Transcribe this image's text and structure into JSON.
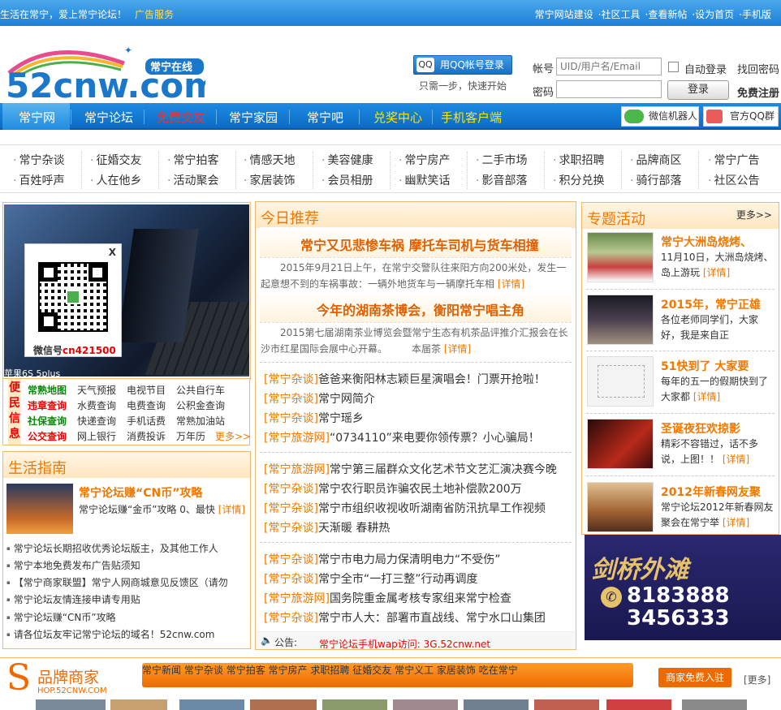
{
  "topbar": {
    "slogan": "生活在常宁，爱上常宁论坛！",
    "ad": "广告服务",
    "links": [
      "常宁网站建设",
      "·社区工具",
      "·查看新帖",
      "·设为首页",
      "·手机版"
    ]
  },
  "logo": {
    "text": "52cnw.com",
    "badge": "常宁在线"
  },
  "login": {
    "qq_button": "用QQ帐号登录",
    "qq_hint": "只需一步，快速开始",
    "account_label": "帐号",
    "account_placeholder": "UID/用户名/Email",
    "password_label": "密码",
    "auto_login": "自动登录",
    "forgot": "找回密码",
    "login_button": "登录",
    "register": "免费注册"
  },
  "nav": {
    "items": [
      "常宁网",
      "常宁论坛",
      "免费交友",
      "常宁家园",
      "常宁吧",
      "兑奖中心",
      "手机客户端"
    ],
    "wechat": "微信机器人",
    "qqgroup": "官方QQ群"
  },
  "categories": {
    "row1": [
      "常宁杂谈",
      "征婚交友",
      "常宁拍客",
      "情感天地",
      "美容健康",
      "常宁房产",
      "二手市场",
      "求职招聘",
      "品牌商区",
      "常宁广告"
    ],
    "row2": [
      "百姓呼声",
      "人在他乡",
      "活动聚会",
      "家居装饰",
      "会员相册",
      "幽默笑话",
      "影音部落",
      "积分兑换",
      "骑行部落",
      "社区公告"
    ]
  },
  "left": {
    "photo_caption": "苹果6S 5plus",
    "qr": {
      "close": "X",
      "caption_prefix": "微信号",
      "caption_id": "cn421500"
    },
    "convenience": {
      "side": "便民信息",
      "rows": [
        [
          "常熟地图",
          "天气预报",
          "电视节目",
          "公共自行车"
        ],
        [
          "违章查询",
          "水费查询",
          "电费查询",
          "公积金查询"
        ],
        [
          "社保查询",
          "快递查询",
          "手机话费",
          "常熟加油站"
        ],
        [
          "公交查询",
          "网上银行",
          "消费投诉",
          "万年历"
        ]
      ],
      "more": "更多>>"
    },
    "guide": {
      "title": "生活指南",
      "feature_title": "常宁论坛赚“CN币”攻略",
      "feature_desc": "常宁论坛赚“金币”攻略 0、最快",
      "feature_more": "[详情]",
      "items": [
        "常宁论坛长期招收优秀论坛版主，及其他工作人",
        "常宁本地免费发布广告贴须知",
        "【常宁商家联盟】常宁人网商城意见反馈区（请勿",
        "常宁论坛友情连接申请专用贴",
        "常宁论坛赚“CN币”攻略",
        "请各位坛友牢记常宁论坛的域名！52cnw.com"
      ]
    }
  },
  "center": {
    "title": "今日推荐",
    "headline1": {
      "title": "常宁又见悲惨车祸 摩托车司机与货车相撞",
      "desc": "2015年9月21日上午，在常宁交警队往来阳方向200米处，发生一起意想不到的车祸事故：一辆外地货车与一辆摩托车相",
      "more": "[详情]"
    },
    "headline2": {
      "title": "今年的湖南茶博会，衡阳常宁唱主角",
      "desc": "2015第七届湖南茶业博览会暨常宁生态有机茶品评推介汇报会在长沙市红星国际会展中心开幕。　　　本届茶",
      "more": "[详情]"
    },
    "group1": [
      {
        "tag": "[常宁杂谈]",
        "text": "爸爸来衡阳林志颖巨星演唱会！门票开抢啦！"
      },
      {
        "tag": "[常宁杂谈]",
        "text": "常宁网简介"
      },
      {
        "tag": "[常宁杂谈]",
        "text": "常宁瑶乡"
      },
      {
        "tag": "[常宁旅游网]",
        "text": "“0734110”来电要你领传票？小心骗局！"
      }
    ],
    "group2": [
      {
        "tag": "[常宁旅游网]",
        "text": "常宁第三届群众文化艺术节文艺汇演决赛今晚"
      },
      {
        "tag": "[常宁杂谈]",
        "text": "常宁农行职员诈骗农民土地补偿款200万"
      },
      {
        "tag": "[常宁杂谈]",
        "text": "常宁市组织收视收听湖南省防汛抗旱工作视频"
      },
      {
        "tag": "[常宁杂谈]",
        "text": "天渐暖 春耕热"
      }
    ],
    "group3": [
      {
        "tag": "[常宁杂谈]",
        "text": "常宁市电力局力保清明电力“不受伤”"
      },
      {
        "tag": "[常宁杂谈]",
        "text": "常宁全市“一打三整”行动再调度"
      },
      {
        "tag": "[常宁旅游网]",
        "text": "国务院重金属考核专家组来常宁检查"
      },
      {
        "tag": "[常宁杂谈]",
        "text": "常宁市人大：部署市直战线、常宁水口山集团"
      }
    ],
    "notice_label": "公告:",
    "notice_text": "常宁论坛手机wap访问: 3G.52cnw.net"
  },
  "right": {
    "title": "专题活动",
    "more": "更多>>",
    "items": [
      {
        "title": "常宁大洲岛烧烤、",
        "desc": "11月10日，大洲岛烧烤、岛上游玩",
        "more": "[详情]"
      },
      {
        "title": "2015年，常宁正雄",
        "desc": "各位老师同学们，大家好，我是来自正",
        "more": ""
      },
      {
        "title": "51快到了 大家要",
        "desc": "每年的五一的假期快到了大家都",
        "more": "[详情]"
      },
      {
        "title": "圣诞夜狂欢掠影",
        "desc": "精彩不容错过，话不多说，上图！！",
        "more": "[详情]"
      },
      {
        "title": "2012年新春网友聚",
        "desc": "常宁论坛2012年新春网友聚会在常宁举",
        "more": "[详情]"
      }
    ],
    "ad": {
      "brand": "剑桥外滩",
      "phone1": "8183888",
      "phone2": "3456333"
    }
  },
  "shop": {
    "title": "品牌商家",
    "domain": "HOP.52CNW.COM",
    "letter": "S",
    "nav": [
      "常宁新闻",
      "常宁杂谈",
      "常宁拍客",
      "常宁房产",
      "求职招聘",
      "征婚交友",
      "常宁义工",
      "家居装饰",
      "吃在常宁"
    ],
    "join": "商家免费入驻",
    "more": "[更多]"
  }
}
